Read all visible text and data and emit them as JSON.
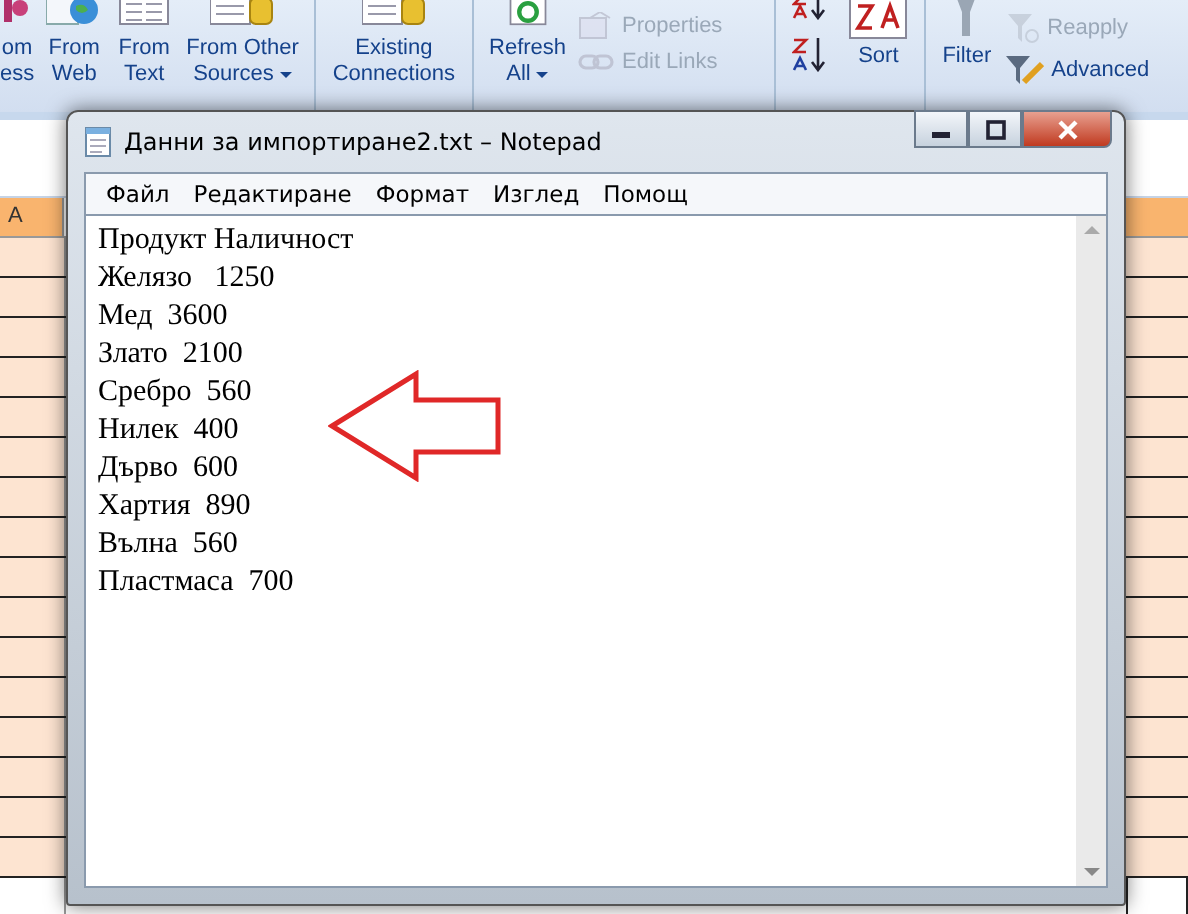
{
  "ribbon": [
    {
      "kind": "large",
      "lines": [
        "om",
        "ess"
      ],
      "dropdown": false
    },
    {
      "kind": "large",
      "lines": [
        "From",
        "Web"
      ],
      "dropdown": false
    },
    {
      "kind": "large",
      "lines": [
        "From",
        "Text"
      ],
      "dropdown": false
    },
    {
      "kind": "large",
      "lines": [
        "From Other",
        "Sources"
      ],
      "dropdown": true
    },
    {
      "kind": "divider"
    },
    {
      "kind": "large",
      "lines": [
        "Existing",
        "Connections"
      ],
      "dropdown": false
    },
    {
      "kind": "divider"
    },
    {
      "kind": "large",
      "lines": [
        "Refresh",
        "All"
      ],
      "dropdown": true
    },
    {
      "kind": "stack",
      "buttons": [
        {
          "label": "Properties",
          "disabled": true
        },
        {
          "label": "Edit Links",
          "disabled": true
        }
      ]
    },
    {
      "kind": "divider"
    },
    {
      "kind": "sort-icons"
    },
    {
      "kind": "large",
      "lines": [
        "Sort"
      ],
      "dropdown": false
    },
    {
      "kind": "divider"
    },
    {
      "kind": "large",
      "lines": [
        "Filter"
      ],
      "dropdown": false
    },
    {
      "kind": "stack",
      "buttons": [
        {
          "label": "Reapply",
          "disabled": true
        },
        {
          "label": "Advanced",
          "disabled": false
        }
      ]
    }
  ],
  "sheet": {
    "column_header": "A"
  },
  "notepad": {
    "title": "Данни за импортиране2.txt – Notepad",
    "menu": [
      "Файл",
      "Редактиране",
      "Формат",
      "Изглед",
      "Помощ"
    ],
    "lines": [
      "Продукт Наличност",
      "Желязо   1250",
      "Мед  3600",
      "Злато  2100",
      "Сребро  560",
      "Нилек  400",
      "Дърво  600",
      "Хартия  890",
      "Вълна  560",
      "Пластмаса  700"
    ]
  }
}
